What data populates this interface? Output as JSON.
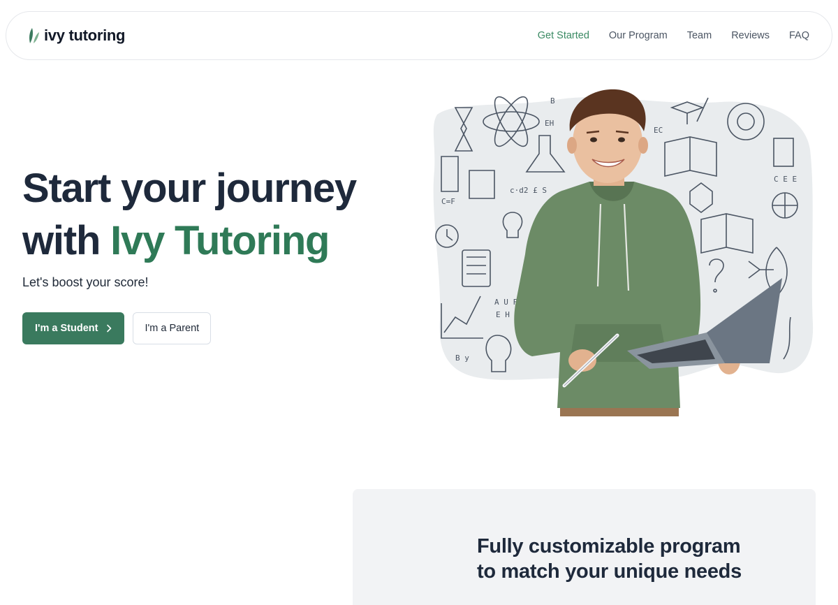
{
  "brand": {
    "name": "ivy tutoring"
  },
  "nav": {
    "items": [
      {
        "label": "Get Started",
        "active": true
      },
      {
        "label": "Our Program"
      },
      {
        "label": "Team"
      },
      {
        "label": "Reviews"
      },
      {
        "label": "FAQ"
      }
    ]
  },
  "hero": {
    "title_line1": "Start your journey",
    "title_line2_prefix": "with ",
    "title_line2_accent": "Ivy Tutoring",
    "subtitle": "Let's boost your score!",
    "primary_button": "I'm a Student",
    "secondary_button": "I'm a Parent"
  },
  "feature": {
    "title_line1": "Fully customizable program",
    "title_line2": "to match your unique needs"
  },
  "colors": {
    "accent": "#2f7a57",
    "nav_active": "#3a8a63",
    "button_primary": "#3a7a5e",
    "heading": "#1e293b",
    "card_bg": "#f2f3f5"
  }
}
